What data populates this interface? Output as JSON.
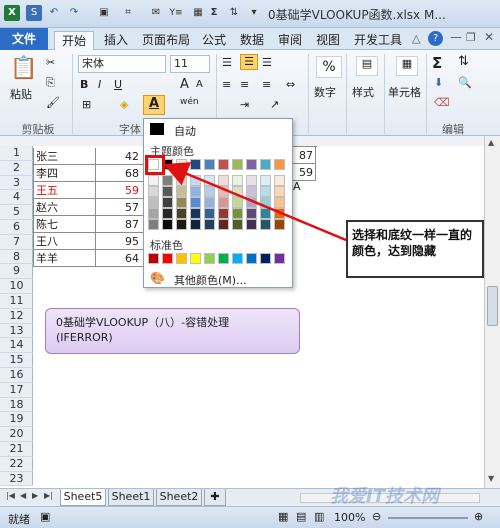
{
  "window": {
    "title": "0基础学VLOOKUP函数.xlsx M...",
    "quick_access": [
      "X",
      "S",
      "U",
      "R"
    ],
    "help_icon": "?"
  },
  "tabs": [
    "文件",
    "开始",
    "插入",
    "页面布局",
    "公式",
    "数据",
    "审阅",
    "视图",
    "开发工具"
  ],
  "ribbon": {
    "clipboard": {
      "paste": "粘贴",
      "label": "剪贴板"
    },
    "font": {
      "name": "宋体",
      "size": "11",
      "bold": "B",
      "italic": "I",
      "underline": "U",
      "a_big": "A",
      "a_small": "A",
      "wen": "wén",
      "label": "字体"
    },
    "number": {
      "label": "数字",
      "percent": "%"
    },
    "style": {
      "label": "样式"
    },
    "cells": {
      "label": "单元格"
    },
    "editing": {
      "label": "编辑",
      "sigma": "Σ"
    }
  },
  "rows": [
    "1",
    "2",
    "3",
    "4",
    "5",
    "6",
    "7",
    "8",
    "9",
    "10",
    "11",
    "12",
    "13",
    "14",
    "15",
    "16",
    "17",
    "18",
    "19",
    "20",
    "21",
    "22",
    "23"
  ],
  "table": [
    {
      "name": "张三",
      "value": "42",
      "red": false
    },
    {
      "name": "李四",
      "value": "68",
      "red": false
    },
    {
      "name": "王五",
      "value": "59",
      "red": true
    },
    {
      "name": "赵六",
      "value": "57",
      "red": false
    },
    {
      "name": "陈七",
      "value": "87",
      "red": false
    },
    {
      "name": "王八",
      "value": "95",
      "red": false
    },
    {
      "name": "羊羊",
      "value": "64",
      "red": false
    }
  ],
  "right_cells": [
    "87",
    "59",
    "A"
  ],
  "color_menu": {
    "auto": "自动",
    "theme_header": "主题颜色",
    "standard_header": "标准色",
    "more": "其他颜色(M)...",
    "theme_top": [
      "#ffffff",
      "#000000",
      "#eeece1",
      "#1f497d",
      "#4f81bd",
      "#c0504d",
      "#9bbb59",
      "#8064a2",
      "#4bacc6",
      "#f79646"
    ],
    "theme_shades": [
      [
        "#f2f2f2",
        "#7f7f7f",
        "#ddd9c3",
        "#c6d9f0",
        "#dbe5f1",
        "#f2dcdb",
        "#ebf1dd",
        "#e5e0ec",
        "#dbeef3",
        "#fdeada"
      ],
      [
        "#d8d8d8",
        "#595959",
        "#c4bd97",
        "#8db3e2",
        "#b8cce4",
        "#e5b9b7",
        "#d7e3bc",
        "#ccc1d9",
        "#b7dde8",
        "#fbd5b5"
      ],
      [
        "#bfbfbf",
        "#3f3f3f",
        "#938953",
        "#548dd4",
        "#95b3d7",
        "#d99694",
        "#c3d69b",
        "#b2a2c7",
        "#92cddc",
        "#fac08f"
      ],
      [
        "#a5a5a5",
        "#262626",
        "#494429",
        "#17365d",
        "#366092",
        "#953734",
        "#76923c",
        "#5f497a",
        "#31859b",
        "#e36c09"
      ],
      [
        "#7f7f7f",
        "#0c0c0c",
        "#1d1b10",
        "#0f243e",
        "#244061",
        "#632423",
        "#4f6128",
        "#3f3151",
        "#205867",
        "#974806"
      ]
    ],
    "standard": [
      "#c00000",
      "#ff0000",
      "#ffc000",
      "#ffff00",
      "#92d050",
      "#00b050",
      "#00b0f0",
      "#0070c0",
      "#002060",
      "#7030a0"
    ]
  },
  "callout": "选择和底纹一样一直的颜色，达到隐藏",
  "note": {
    "line1": "0基础学VLOOKUP（八）-容错处理",
    "line2": "(IFERROR)"
  },
  "sheets": [
    "Sheet5",
    "Sheet1",
    "Sheet2"
  ],
  "status": {
    "ready": "就绪",
    "zoom": "100%"
  },
  "watermark": "我爱IT技术网"
}
